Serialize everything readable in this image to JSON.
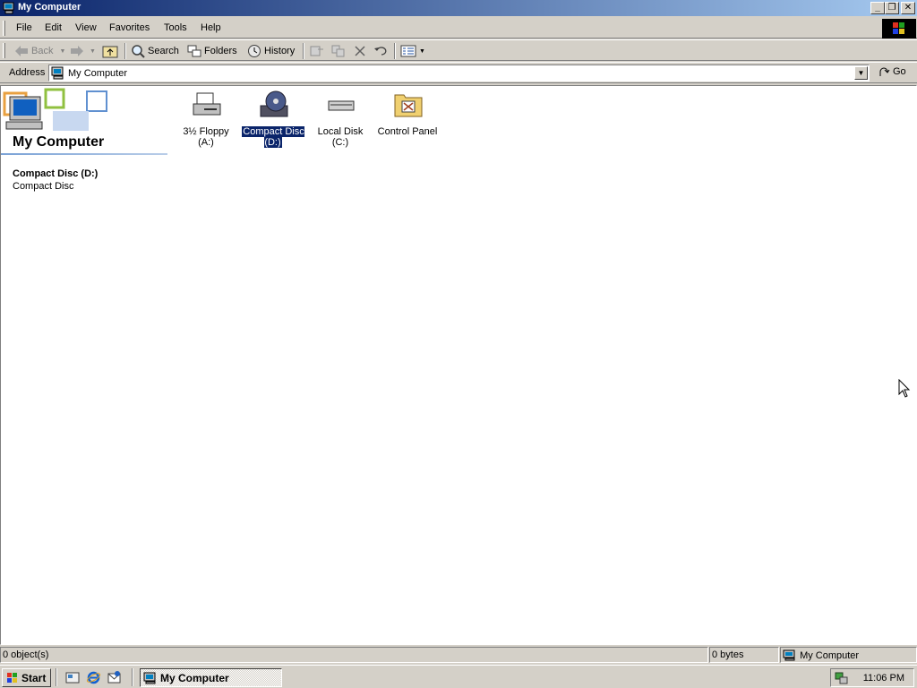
{
  "window": {
    "title": "My Computer",
    "controls": [
      "minimize",
      "restore",
      "close"
    ]
  },
  "menubar": {
    "items": [
      "File",
      "Edit",
      "View",
      "Favorites",
      "Tools",
      "Help"
    ]
  },
  "toolbar": {
    "back_label": "Back",
    "search_label": "Search",
    "folders_label": "Folders",
    "history_label": "History"
  },
  "address": {
    "label": "Address",
    "value": "My Computer",
    "go_label": "Go"
  },
  "left_pane": {
    "title": "My Computer",
    "selected_name": "Compact Disc (D:)",
    "selected_type": "Compact Disc"
  },
  "icons": [
    {
      "label": "3½ Floppy (A:)",
      "icon": "floppy-drive-icon",
      "selected": false
    },
    {
      "label": "Compact Disc (D:)",
      "icon": "cd-drive-icon",
      "selected": true
    },
    {
      "label": "Local Disk (C:)",
      "icon": "hard-disk-icon",
      "selected": false
    },
    {
      "label": "Control Panel",
      "icon": "control-panel-icon",
      "selected": false
    }
  ],
  "statusbar": {
    "objects": "0 object(s)",
    "size": "0 bytes",
    "zone": "My Computer"
  },
  "taskbar": {
    "start_label": "Start",
    "task_label": "My Computer",
    "clock": "11:06 PM"
  },
  "colors": {
    "title_gradient_start": "#0a246a",
    "title_gradient_end": "#a6caf0",
    "selection": "#0a246a",
    "face": "#d4d0c8"
  }
}
